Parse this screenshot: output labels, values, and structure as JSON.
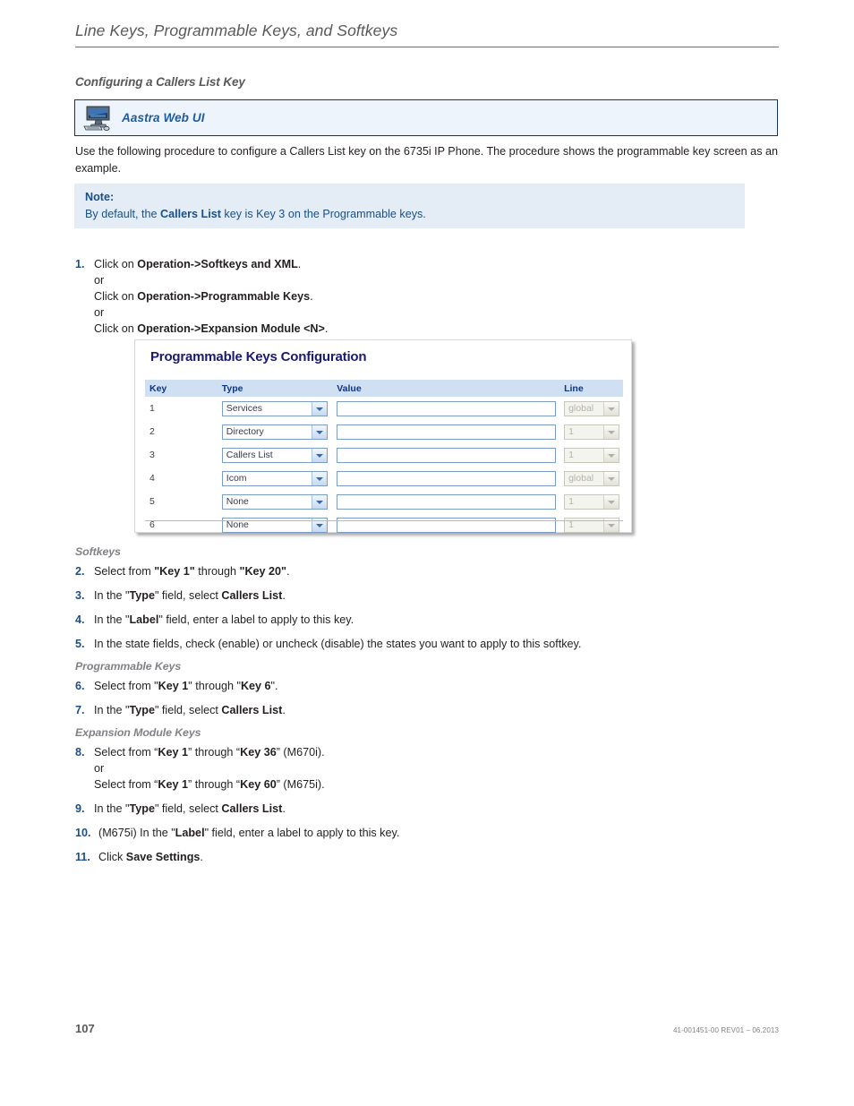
{
  "header": {
    "running_title": "Line Keys, Programmable Keys, and Softkeys"
  },
  "section": {
    "heading": "Configuring a Callers List Key"
  },
  "callout": {
    "icon": "desktop-computer-icon",
    "label": "Aastra Web UI",
    "border_color": "#15355e",
    "background_color": "#eef4fb",
    "text_color": "#1f5c99"
  },
  "intro": {
    "text": "Use the following procedure to configure a Callers List key on the 6735i IP Phone. The procedure shows the programmable key screen as an example."
  },
  "note": {
    "title": "Note:",
    "prefix": "By default, the ",
    "bold": "Callers List",
    "suffix": " key is Key 3 on the Programmable keys.",
    "background_color": "#e4edf6",
    "text_color": "#1b4f86"
  },
  "steps": {
    "step1": {
      "num": "1.",
      "line1_prefix": "Click on ",
      "line1_bold": "Operation->Softkeys and XML",
      "line1_suffix": ".",
      "or1": "or",
      "line2_prefix": "Click on ",
      "line2_bold": "Operation->Programmable Keys",
      "line2_suffix": ".",
      "or2": "or",
      "line3_prefix": "Click on ",
      "line3_bold": "Operation->Expansion Module <N>",
      "line3_suffix": "."
    },
    "step2": {
      "num": "2.",
      "p1": "Select from ",
      "b1": "\"Key 1\"",
      "p2": " through ",
      "b2": "\"Key 20\"",
      "p3": "."
    },
    "step3": {
      "num": "3.",
      "p1": "In the \"",
      "b1": "Type",
      "p2": "\" field, select ",
      "b2": "Callers List",
      "p3": "."
    },
    "step4": {
      "num": "4.",
      "p1": "In the \"",
      "b1": "Label",
      "p2": "\" field, enter a label to apply to this key."
    },
    "step5": {
      "num": "5.",
      "p1": "In the state fields, check (enable) or uncheck (disable) the states you want to apply to this softkey."
    },
    "step6": {
      "num": "6.",
      "p1": "Select from \"",
      "b1": "Key 1",
      "p2": "\" through \"",
      "b2": "Key 6",
      "p3": "\"."
    },
    "step7": {
      "num": "7.",
      "p1": "In the \"",
      "b1": "Type",
      "p2": "\" field, select ",
      "b2": "Callers List",
      "p3": "."
    },
    "step8": {
      "num": "8.",
      "p1": "Select from “",
      "b1": "Key 1",
      "p2": "” through “",
      "b2": "Key 36",
      "p3": "” (M670i).",
      "or": "or",
      "p4": "Select from “",
      "b3": "Key 1",
      "p5": "” through “",
      "b4": "Key 60",
      "p6": "” (M675i)."
    },
    "step9": {
      "num": "9.",
      "p1": "In the \"",
      "b1": "Type",
      "p2": "\" field, select ",
      "b2": "Callers List",
      "p3": "."
    },
    "step10": {
      "num": "10.",
      "p1": "(M675i) In the \"",
      "b1": "Label",
      "p2": "\" field, enter a label to apply to this key."
    },
    "step11": {
      "num": "11.",
      "p1": "Click ",
      "b1": "Save Settings",
      "p2": "."
    }
  },
  "sub_headings": {
    "softkeys": "Softkeys",
    "programmable_keys": "Programmable Keys",
    "expansion_module_keys": "Expansion Module Keys"
  },
  "screenshot": {
    "title": "Programmable Keys Configuration",
    "columns": [
      "Key",
      "Type",
      "Value",
      "Line"
    ],
    "rows": [
      {
        "key": "1",
        "type": "Services",
        "value": "",
        "line": "global",
        "line_disabled": true
      },
      {
        "key": "2",
        "type": "Directory",
        "value": "",
        "line": "1",
        "line_disabled": true
      },
      {
        "key": "3",
        "type": "Callers List",
        "value": "",
        "line": "1",
        "line_disabled": true
      },
      {
        "key": "4",
        "type": "Icom",
        "value": "",
        "line": "global",
        "line_disabled": true
      },
      {
        "key": "5",
        "type": "None",
        "value": "",
        "line": "1",
        "line_disabled": true
      },
      {
        "key": "6",
        "type": "None",
        "value": "",
        "line": "1",
        "line_disabled": true
      }
    ],
    "header_bg": "#cfe0f3",
    "header_text_color": "#12357f",
    "title_color": "#1a1a6e"
  },
  "footer": {
    "page_number": "107",
    "document_id": "41-001451-00 REV01 – 06.2013"
  }
}
